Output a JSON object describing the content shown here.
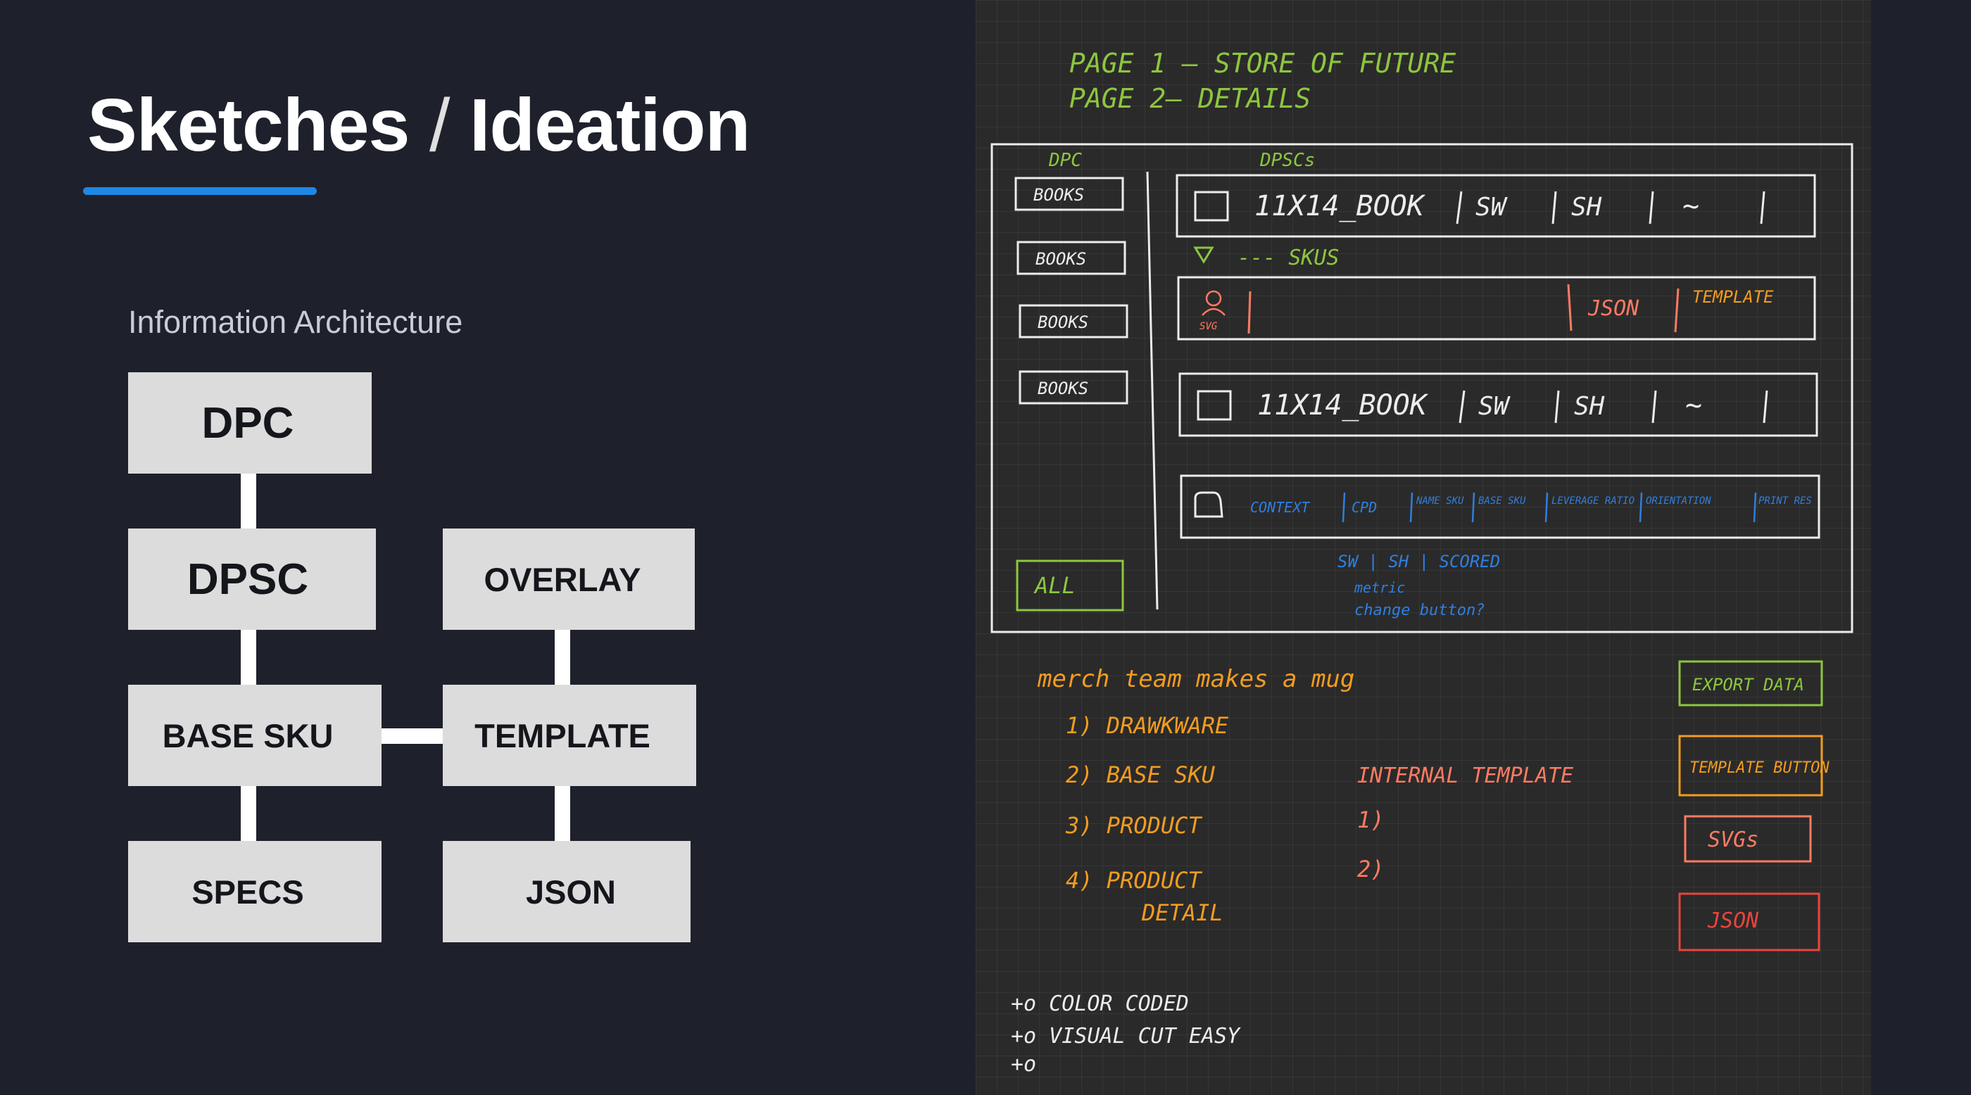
{
  "slide": {
    "title_main": "Sketches",
    "title_sep": "/",
    "title_sub": "Ideation",
    "subtitle": "Information Architecture",
    "accent_color": "#1e88e5"
  },
  "ia": {
    "nodes": [
      {
        "id": "dpc",
        "label": "DPC"
      },
      {
        "id": "dpsc",
        "label": "DPSC"
      },
      {
        "id": "base-sku",
        "label": "BASE SKU"
      },
      {
        "id": "specs",
        "label": "SPECS"
      },
      {
        "id": "overlay",
        "label": "OVERLAY"
      },
      {
        "id": "template",
        "label": "TEMPLATE"
      },
      {
        "id": "json",
        "label": "JSON"
      }
    ]
  },
  "sketch": {
    "header": {
      "line1": "PAGE 1 — STORE OF FUTURE",
      "line2": "PAGE 2— DETAILS",
      "color": "#8dc63f"
    },
    "wireframe": {
      "dpc_label": "DPC",
      "dpscs_label": "DPSCs",
      "sidebar_items": [
        "BOOKS",
        "BOOKS",
        "BOOKS",
        "BOOKS"
      ],
      "all_button": "ALL",
      "rows": [
        {
          "name": "11X14_BOOK",
          "c1": "SW",
          "c2": "SH",
          "c3": "~"
        },
        {
          "name": "11X14_BOOK",
          "c1": "SW",
          "c2": "SH",
          "c3": "~"
        }
      ],
      "skus_label": "--- SKUS",
      "svg_label": "SVG",
      "json_col": "JSON",
      "template_col": "TEMPLATE",
      "detail_cols": [
        "CONTEXT",
        "CPD",
        "NAME SKU",
        "BASE SKU",
        "LEVERAGE RATIO",
        "ORIENTATION",
        "PRINT RES"
      ],
      "note_line1": "SW | SH | SCORED",
      "note_line2": "metric",
      "note_line3": "change button?"
    },
    "notes": {
      "heading": "merch team makes a mug",
      "steps": [
        "1) DRAWKWARE",
        "2) BASE SKU",
        "3) PRODUCT",
        "4) PRODUCT"
      ],
      "step4_cont": "DETAIL",
      "internal": "INTERNAL TEMPLATE",
      "internal_items": [
        "1)",
        "2)"
      ],
      "buttons": [
        "EXPORT DATA",
        "TEMPLATE BUTTON",
        "SVGs",
        "JSON"
      ],
      "todos": [
        "+o COLOR CODED",
        "+o VISUAL CUT EASY",
        "+o"
      ]
    },
    "colors": {
      "green": "#8dc63f",
      "orange": "#f39c1f",
      "salmon": "#ff7b63",
      "red": "#e8453c",
      "blue": "#2f7fe0",
      "white": "#ececec"
    }
  }
}
